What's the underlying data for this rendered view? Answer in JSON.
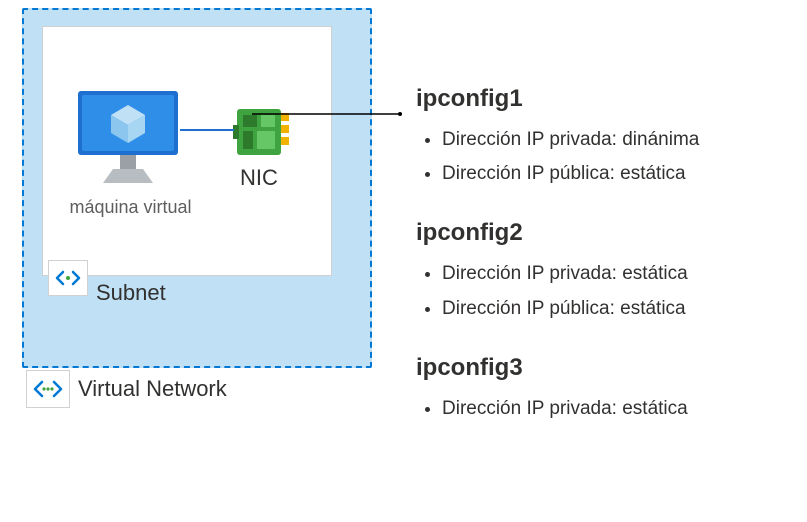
{
  "diagram": {
    "virtual_network_label": "Virtual Network",
    "subnet_label": "Subnet",
    "vm_label": "máquina virtual",
    "nic_label": "NIC"
  },
  "configs": [
    {
      "name": "ipconfig1",
      "items": [
        "Dirección IP privada: dinánima",
        "Dirección IP pública: estática"
      ]
    },
    {
      "name": "ipconfig2",
      "items": [
        "Dirección IP privada: estática",
        "Dirección IP pública: estática"
      ]
    },
    {
      "name": "ipconfig3",
      "items": [
        "Dirección IP privada: estática"
      ]
    }
  ]
}
